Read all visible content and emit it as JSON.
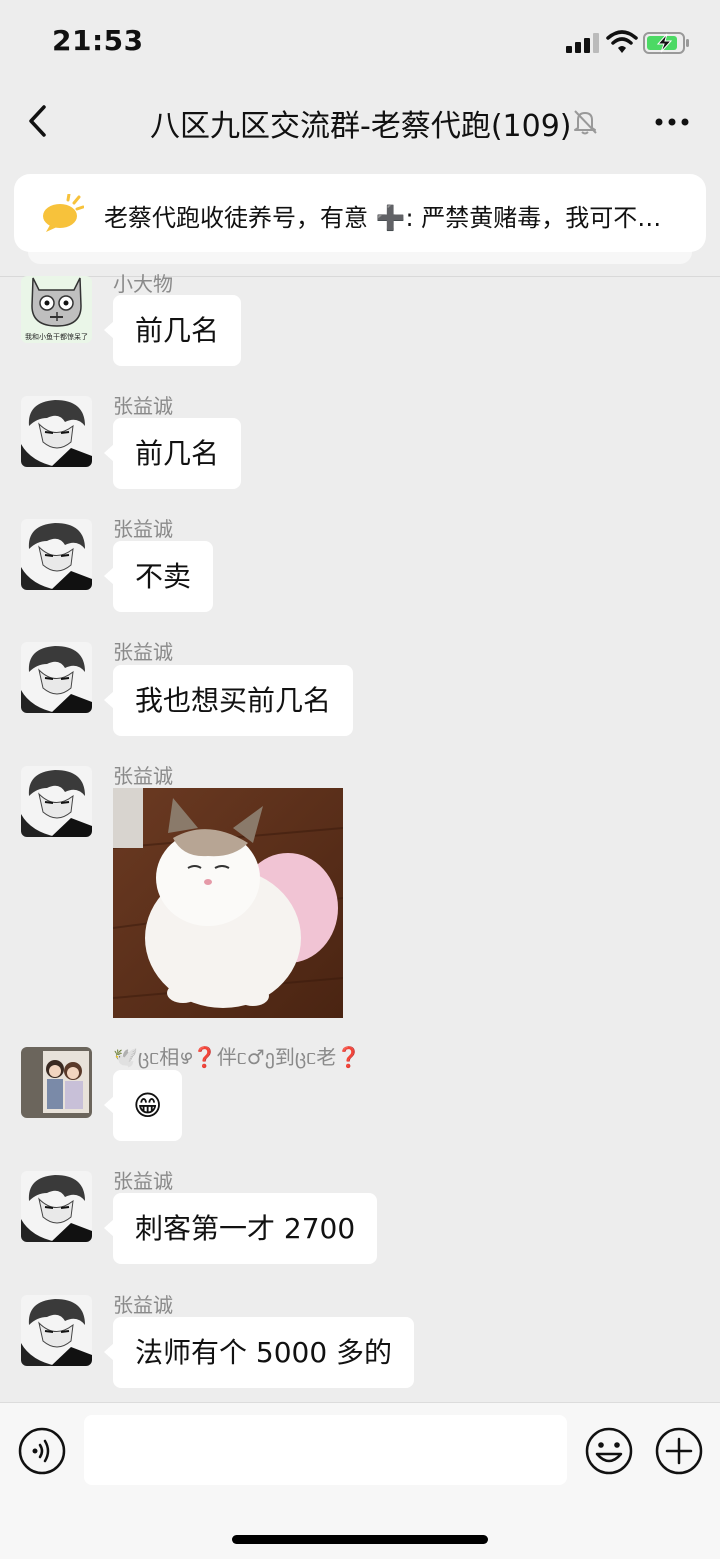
{
  "status_bar": {
    "time": "21:53",
    "battery_color": "#4cd964"
  },
  "header": {
    "title": "八区九区交流群-老蔡代跑(109)"
  },
  "notice": {
    "text": "老蔡代跑收徒养号，有意 ➕: 严禁黄赌毒，我可不…"
  },
  "messages": [
    {
      "sender": "小大物",
      "text": "前几名",
      "avatar": "cat-sticker"
    },
    {
      "sender": "张益诚",
      "text": "前几名",
      "avatar": "anime-boy"
    },
    {
      "sender": "张益诚",
      "text": "不卖",
      "avatar": "anime-boy"
    },
    {
      "sender": "张益诚",
      "text": "我也想买前几名",
      "avatar": "anime-boy"
    },
    {
      "sender": "张益诚",
      "image": "fluffy-cat-photo",
      "avatar": "anime-boy"
    },
    {
      "sender": "🕊️ცᥴ相ഴ❓伴ᥴ♂ე到ცᥴ老❓",
      "text": "😁",
      "avatar": "couple-photo"
    },
    {
      "sender": "张益诚",
      "text": "刺客第一才 2700",
      "avatar": "anime-boy"
    },
    {
      "sender": "张益诚",
      "text": "法师有个 5000 多的",
      "avatar": "anime-boy"
    }
  ],
  "avatar_captions": {
    "cat_sticker": "我和小鱼干都惊呆了"
  }
}
